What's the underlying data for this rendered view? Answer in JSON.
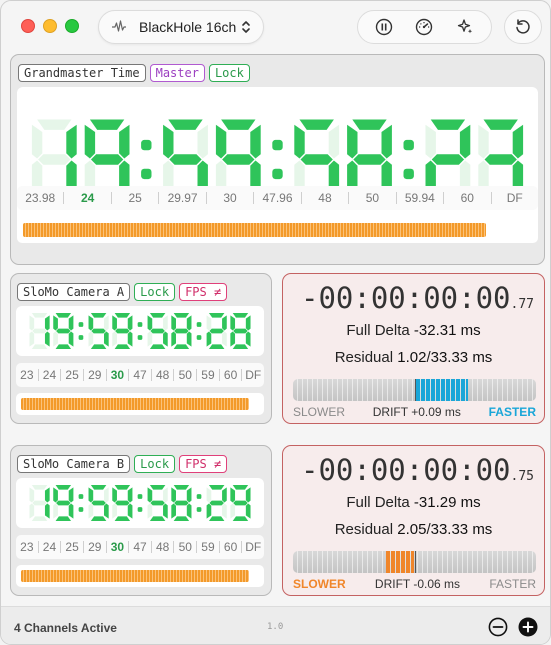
{
  "toolbar": {
    "device_name": "BlackHole 16ch",
    "icons": [
      "waveform-icon",
      "chevron-updown-icon",
      "pause-icon",
      "gauge-icon",
      "sparkles-icon",
      "reset-icon"
    ]
  },
  "grandmaster": {
    "tags": [
      "Grandmaster Time",
      "Master",
      "Lock"
    ],
    "timecode": "19:59:58:23",
    "frame_rates": [
      "23.98",
      "24",
      "25",
      "29.97",
      "30",
      "47.96",
      "48",
      "50",
      "59.94",
      "60",
      "DF"
    ],
    "active_rate": "24",
    "progress": 0.91
  },
  "cameras": [
    {
      "tags": [
        "SloMo Camera A",
        "Lock",
        "FPS ≠"
      ],
      "timecode": "19:59:58:28",
      "frame_rates": [
        "23",
        "24",
        "25",
        "29",
        "30",
        "47",
        "48",
        "50",
        "59",
        "60",
        "DF"
      ],
      "active_rate": "30",
      "progress": 0.96,
      "delta_timecode": "-00:00:00:00",
      "delta_subframe": ".77",
      "full_delta_label": "Full Delta",
      "full_delta_value": "-32.31 ms",
      "residual_label": "Residual",
      "residual_value": "1.02",
      "residual_of": "33.33 ms",
      "drift_label": "DRIFT",
      "drift_value": "+0.09 ms",
      "slower_label": "SLOWER",
      "faster_label": "FASTER",
      "drift_direction": "faster",
      "drift_color": "#1aa6d8"
    },
    {
      "tags": [
        "SloMo Camera B",
        "Lock",
        "FPS ≠"
      ],
      "timecode": "19:59:58:29",
      "frame_rates": [
        "23",
        "24",
        "25",
        "29",
        "30",
        "47",
        "48",
        "50",
        "59",
        "60",
        "DF"
      ],
      "active_rate": "30",
      "progress": 0.96,
      "delta_timecode": "-00:00:00:00",
      "delta_subframe": ".75",
      "full_delta_label": "Full Delta",
      "full_delta_value": "-31.29 ms",
      "residual_label": "Residual",
      "residual_value": "2.05",
      "residual_of": "33.33 ms",
      "drift_label": "DRIFT",
      "drift_value": "-0.06 ms",
      "slower_label": "SLOWER",
      "faster_label": "FASTER",
      "drift_direction": "slower",
      "drift_color": "#f0862a"
    }
  ],
  "footer": {
    "status": "4 Channels Active",
    "version": "1.0"
  },
  "colors": {
    "lcd_on": "#2fc45a",
    "lcd_off": "#e6f6e9",
    "accent_orange": "#f39a2a",
    "accent_blue": "#1aa6d8",
    "delta_border": "#c46262"
  }
}
